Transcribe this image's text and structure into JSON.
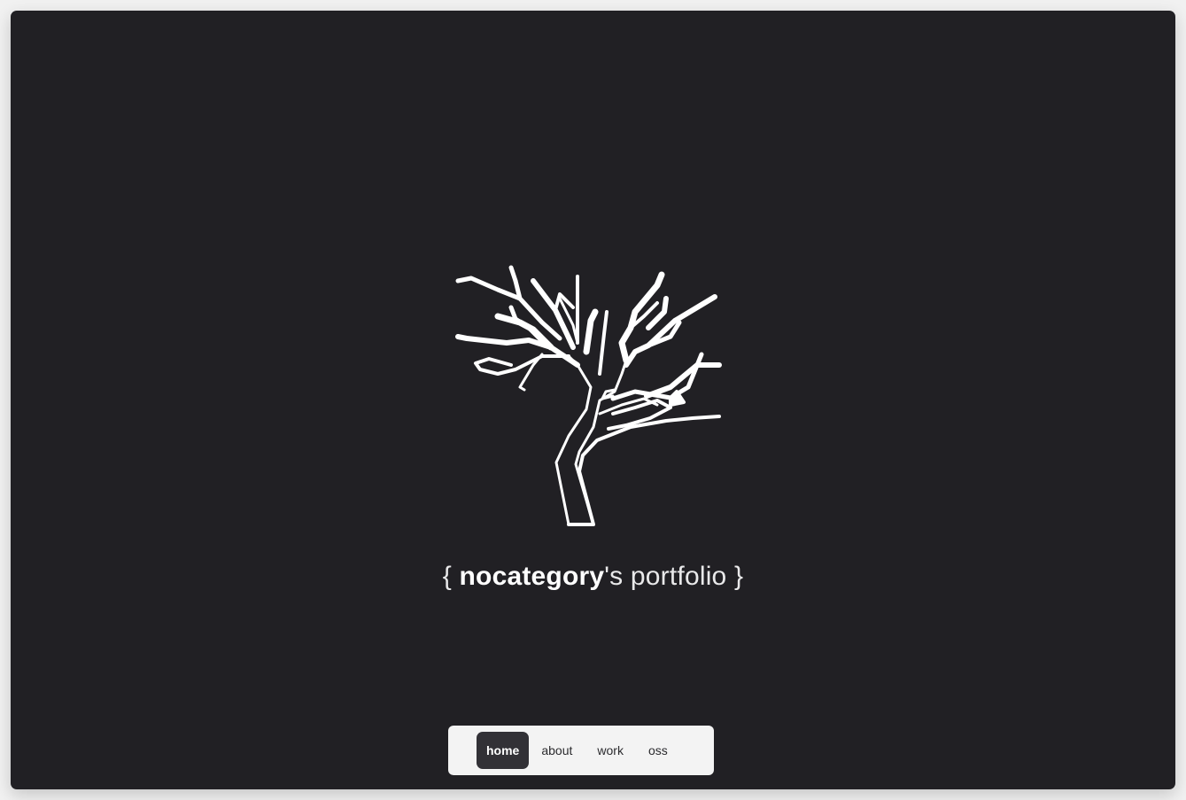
{
  "title": {
    "open_brace": "{",
    "name": "nocategory",
    "suffix": "'s portfolio",
    "close_brace": "}"
  },
  "nav": {
    "items": [
      {
        "label": "home",
        "active": true
      },
      {
        "label": "about",
        "active": false
      },
      {
        "label": "work",
        "active": false
      },
      {
        "label": "oss",
        "active": false
      }
    ]
  },
  "colors": {
    "background": "#212024",
    "nav_background": "#f3f3f3",
    "nav_active": "#323136",
    "logo": "#ffffff"
  },
  "icons": {
    "logo": "tree-logo-icon"
  }
}
